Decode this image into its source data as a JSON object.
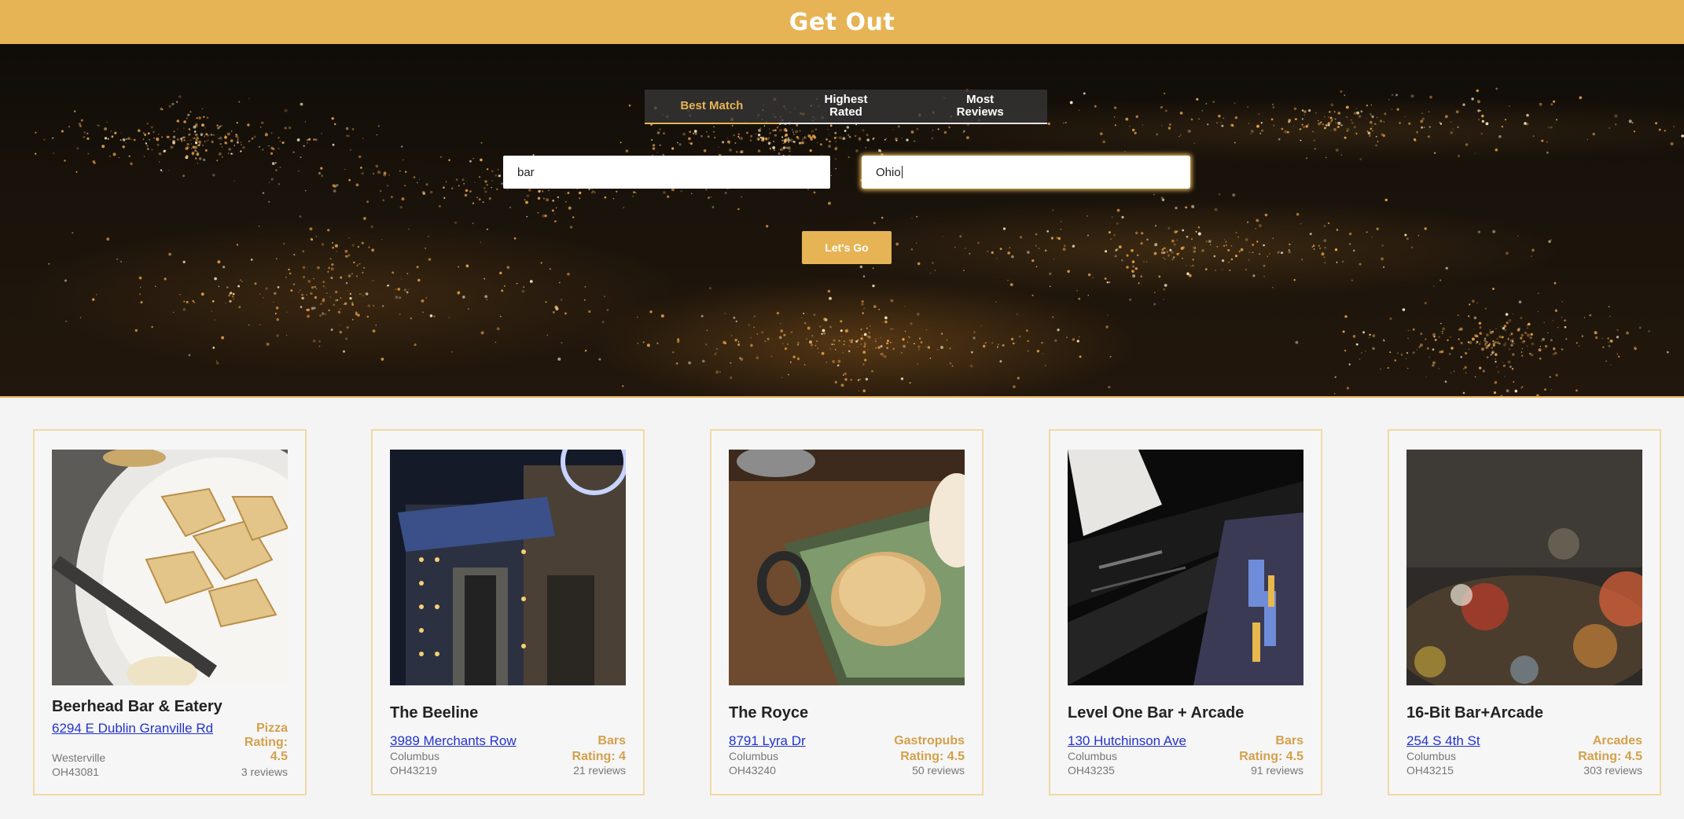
{
  "header": {
    "title": "Get Out"
  },
  "tabs": [
    {
      "label": "Best Match",
      "active": true
    },
    {
      "label": "Highest Rated",
      "active": false
    },
    {
      "label": "Most Reviews",
      "active": false
    }
  ],
  "search": {
    "term_value": "bar",
    "location_value": "Ohio"
  },
  "go_button": {
    "label": "Let's Go"
  },
  "colors": {
    "accent": "#e6b455",
    "link": "#2233cc",
    "card_border": "#f1d9a4"
  },
  "results": [
    {
      "name": "Beerhead Bar & Eatery",
      "address": "6294 E Dublin Granville Rd",
      "city": "Westerville",
      "zip": "OH43081",
      "category": "Pizza",
      "rating": "Rating: 4.5",
      "reviews": "3 reviews",
      "photo": "flatbread-plate"
    },
    {
      "name": "The Beeline",
      "address": "3989 Merchants Row",
      "city": "Columbus",
      "zip": "OH43219",
      "category": "Bars",
      "rating": "Rating: 4",
      "reviews": "21 reviews",
      "photo": "building-exterior"
    },
    {
      "name": "The Royce",
      "address": "8791 Lyra Dr",
      "city": "Columbus",
      "zip": "OH43240",
      "category": "Gastropubs",
      "rating": "Rating: 4.5",
      "reviews": "50 reviews",
      "photo": "dessert-dish"
    },
    {
      "name": "Level One Bar + Arcade",
      "address": "130 Hutchinson Ave",
      "city": "Columbus",
      "zip": "OH43235",
      "category": "Bars",
      "rating": "Rating: 4.5",
      "reviews": "91 reviews",
      "photo": "pinball-machine"
    },
    {
      "name": "16-Bit Bar+Arcade",
      "address": "254 S 4th St",
      "city": "Columbus",
      "zip": "OH43215",
      "category": "Arcades",
      "rating": "Rating: 4.5",
      "reviews": "303 reviews",
      "photo": "arcade-blur"
    }
  ]
}
